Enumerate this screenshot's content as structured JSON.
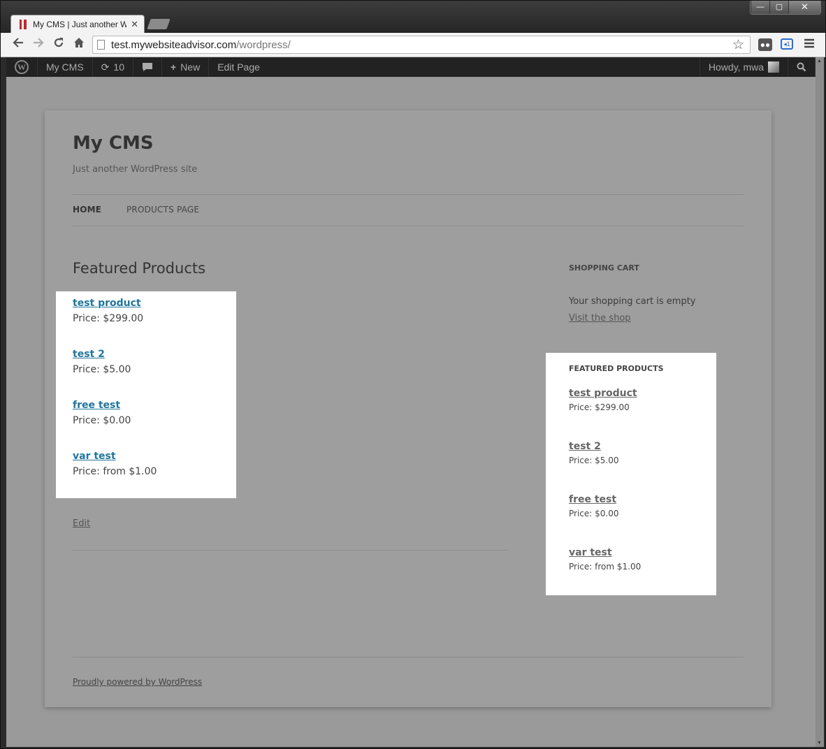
{
  "browser": {
    "tab_title": "My CMS | Just another Wo",
    "tab_close": "✕",
    "url_host": "test.mywebsiteadvisor.com",
    "url_path": "/wordpress/",
    "window_controls": [
      "—",
      "▢",
      "✕"
    ]
  },
  "icons": {
    "back": "back-arrow-icon",
    "forward": "forward-arrow-icon",
    "reload": "reload-icon",
    "home": "home-icon",
    "star": "star-icon",
    "menu": "menu-icon"
  },
  "adminbar": {
    "logo": "W",
    "site_name": "My CMS",
    "updates_count": "10",
    "new_label": "New",
    "edit_label": "Edit Page",
    "howdy": "Howdy, mwa"
  },
  "site": {
    "title": "My CMS",
    "description": "Just another WordPress site"
  },
  "nav": {
    "home": "HOME",
    "products": "PRODUCTS PAGE"
  },
  "main": {
    "heading": "Featured Products",
    "products": [
      {
        "name": "test product",
        "price": "Price: $299.00"
      },
      {
        "name": "test 2",
        "price": "Price: $5.00"
      },
      {
        "name": "free test",
        "price": "Price: $0.00"
      },
      {
        "name": "var test",
        "price": "Price: from $1.00"
      }
    ],
    "edit": "Edit"
  },
  "sidebar": {
    "cart_title": "SHOPPING CART",
    "cart_empty": "Your shopping cart is empty",
    "visit_shop": "Visit the shop",
    "featured_title": "FEATURED PRODUCTS",
    "products": [
      {
        "name": "test product",
        "price": "Price: $299.00"
      },
      {
        "name": "test 2",
        "price": "Price: $5.00"
      },
      {
        "name": "free test",
        "price": "Price: $0.00"
      },
      {
        "name": "var test",
        "price": "Price: from $1.00"
      }
    ]
  },
  "footer": {
    "powered": "Proudly powered by WordPress"
  }
}
